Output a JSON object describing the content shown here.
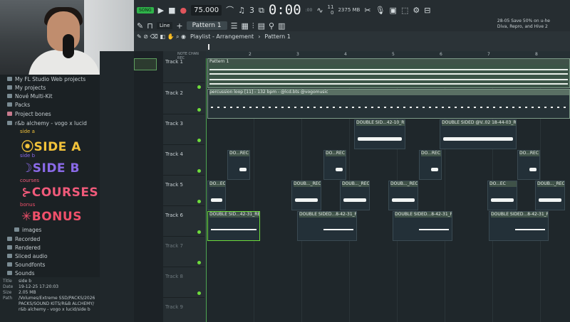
{
  "toolbar": {
    "mode": "SONG",
    "tempo": "75.000",
    "time": "0:00",
    "time_unit": "M:S:CS",
    "time_frac": ":00",
    "pattern": "Pattern 1",
    "snap": "Line",
    "mem_top": "11",
    "mem_mb": "2375 MB",
    "mem_zero": "0",
    "hint_date": "28-05",
    "hint_line1": "Save 50% on u-he",
    "hint_line2": "Diva, Repro, and Hive 2"
  },
  "playlist": {
    "title": "Playlist - Arrangement",
    "breadcrumb_sep": "›",
    "current_pattern": "Pattern 1",
    "chan_labels": [
      "NOTE",
      "CHAN",
      "REC"
    ],
    "ruler": [
      "2",
      "3",
      "4",
      "5",
      "6",
      "7",
      "8"
    ]
  },
  "tracks": [
    {
      "name": "Track 1"
    },
    {
      "name": "Track 2"
    },
    {
      "name": "Track 3"
    },
    {
      "name": "Track 4"
    },
    {
      "name": "Track 5"
    },
    {
      "name": "Track 6"
    },
    {
      "name": "Track 7"
    },
    {
      "name": "Track 8"
    },
    {
      "name": "Track 9"
    }
  ],
  "clips": {
    "pattern1": "Pattern 1",
    "perc_loop": "percussion loop [11] - 132 bpm - @lcd.bts @vogomusic",
    "t3a": "DOUBLE SID...42-10_REC",
    "t3b": "DOUBLE SIDED @V..02 18-44-03_REC",
    "t4": "DO...REC",
    "t5": "DO...EC",
    "t5b": "DOUB..._REC",
    "t6": "DOUBLE SID...42-31_REC",
    "t6b": "DOUBLE SIDED...8-42-31_REC"
  },
  "browser": {
    "items": [
      "My FL Studio Web projects",
      "My projects",
      "Nové Multi-Kit",
      "Packs",
      "Project bones",
      "r&b alchemy - vogo x lucid"
    ],
    "side_a_label": "side a",
    "side_a": "SIDE A",
    "side_b_label": "side b",
    "side_b": "SIDE B",
    "courses_label": "courses",
    "courses": "COURSES",
    "bonus_label": "bonus",
    "bonus": "BONUS",
    "lower": [
      "images",
      "Recorded",
      "Rendered",
      "Sliced audio",
      "Soundfonts",
      "Sounds"
    ],
    "info": {
      "title_k": "Title",
      "title_v": "side b",
      "date_k": "Date",
      "date_v": "19-12-25 17:20:03",
      "size_k": "Size",
      "size_v": "2.05 MB",
      "path_k": "Path",
      "path_v": "/Volumes/Extreme SSD/PACKS/2026 PACKS/SOUND KITS/R&B ALCHEMY/r&b alchemy - vogo x lucid/side b"
    }
  },
  "colors": {
    "side_a": "#f2c23a",
    "side_b": "#8a6ae8",
    "courses": "#f05a7a",
    "bonus": "#f0506a",
    "clip": "#5a7064",
    "led": "#6edc3c"
  }
}
